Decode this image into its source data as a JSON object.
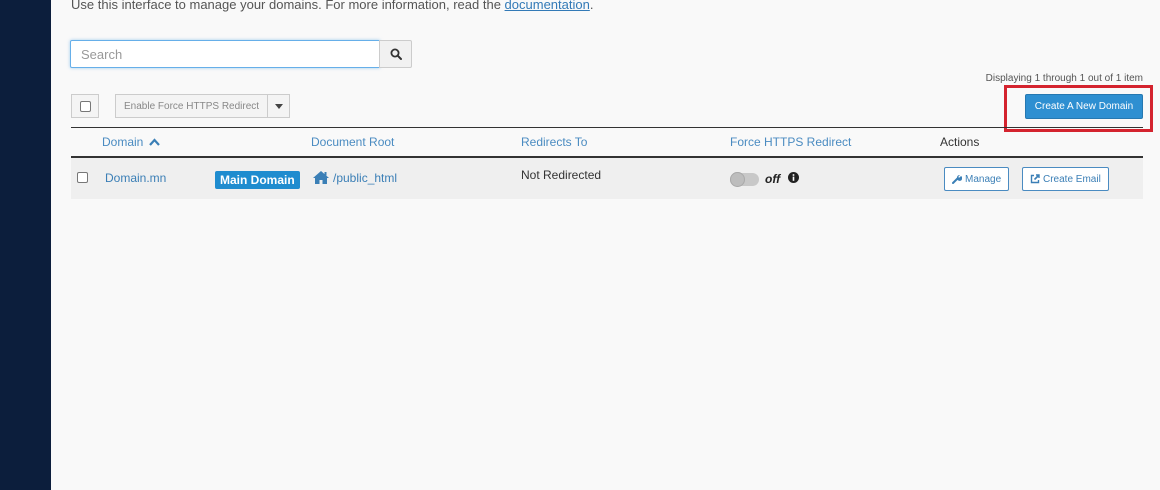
{
  "intro": {
    "text": "Use this interface to manage your domains. For more information, read the ",
    "link": "documentation",
    "end": "."
  },
  "search": {
    "placeholder": "Search",
    "button_icon": "search-icon"
  },
  "paging": {
    "text": "Displaying 1 through 1 out of 1 item"
  },
  "bulk": {
    "label": "Enable Force HTTPS Redirect",
    "caret_icon": "caret-down-icon"
  },
  "create_button": {
    "label": "Create A New Domain",
    "highlight_color": "#d4232e"
  },
  "table": {
    "headers": {
      "domain": "Domain",
      "document_root": "Document Root",
      "redirects_to": "Redirects To",
      "force_https": "Force HTTPS Redirect",
      "actions": "Actions"
    },
    "sort_icon": "chevron-up-icon",
    "rows": [
      {
        "domain": "Domain.mn",
        "badge": "Main Domain",
        "document_root": "/public_html",
        "redirects_to": "Not Redirected",
        "force_https_state": "off",
        "force_https_label": "off",
        "manage_label": "Manage",
        "email_label": "Create Email"
      }
    ]
  },
  "colors": {
    "sidebar": "#0c1e3c",
    "primary": "#2e8fd1",
    "link": "#3b7fb6",
    "badge": "#1f8ccf"
  }
}
